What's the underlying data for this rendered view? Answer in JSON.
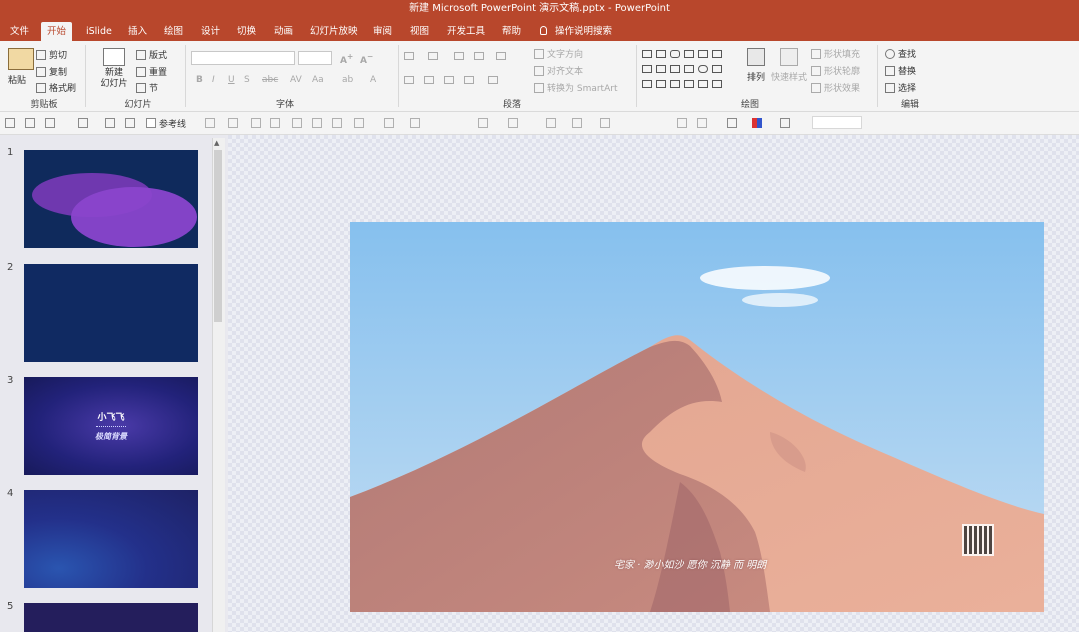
{
  "window": {
    "title": "新建 Microsoft PowerPoint 演示文稿.pptx  -  PowerPoint"
  },
  "tabs": [
    "文件",
    "开始",
    "iSlide",
    "插入",
    "绘图",
    "设计",
    "切换",
    "动画",
    "幻灯片放映",
    "审阅",
    "视图",
    "开发工具",
    "帮助"
  ],
  "active_tab": "开始",
  "tell_me": "操作说明搜索",
  "ribbon": {
    "clipboard": {
      "paste": "粘贴",
      "cut": "剪切",
      "copy": "复制",
      "format_painter": "格式刷",
      "label": "剪贴板"
    },
    "slides": {
      "new_slide": "新建\n幻灯片",
      "layout": "版式",
      "reset": "重置",
      "section": "节",
      "label": "幻灯片"
    },
    "font": {
      "label": "字体"
    },
    "paragraph": {
      "text_direction": "文字方向",
      "align_text": "对齐文本",
      "convert_smartart": "转换为 SmartArt",
      "label": "段落"
    },
    "drawing": {
      "arrange": "排列",
      "quick_styles": "快速样式",
      "shape_fill": "形状填充",
      "shape_outline": "形状轮廓",
      "shape_effects": "形状效果",
      "label": "绘图"
    },
    "editing": {
      "find": "查找",
      "replace": "替换",
      "select": "选择",
      "label": "编辑"
    }
  },
  "quick_toolbar": {
    "guides_checkbox": "参考线"
  },
  "thumbnails": [
    {
      "num": "1",
      "bg": "#0f2a5c"
    },
    {
      "num": "2",
      "bg": "#102a62"
    },
    {
      "num": "3",
      "bg": "#22227a",
      "title": "小飞飞",
      "subtitle": "极简背景"
    },
    {
      "num": "4",
      "bg": "#1e2266"
    },
    {
      "num": "5",
      "bg": "#241e5c"
    }
  ],
  "colors": {
    "accent": "#b8472c",
    "ribbon_bg": "#f4f4f4"
  },
  "slide": {
    "caption": "宅家 · 渺小如沙  愿你 沉静 而 明朗"
  }
}
